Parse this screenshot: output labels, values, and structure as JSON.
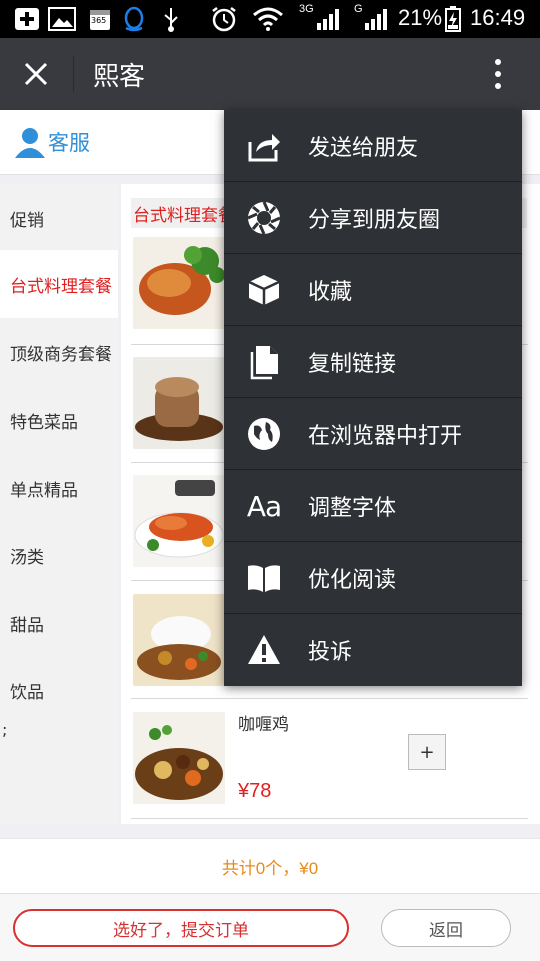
{
  "status_bar": {
    "battery": "21%",
    "time": "16:49",
    "network_a": "3G",
    "network_b": "G",
    "calendar_icon_text": "365",
    "icons": [
      "add-icon",
      "image-icon",
      "calendar-icon",
      "qq-icon",
      "usb-icon",
      "alarm-icon",
      "wifi-icon",
      "signal-icon",
      "signal-icon",
      "battery-charging-icon"
    ]
  },
  "titlebar": {
    "title": "熙客"
  },
  "service": {
    "label": "客服"
  },
  "sidebar": {
    "items": [
      {
        "label": "促销",
        "active": false
      },
      {
        "label": "台式料理套餐",
        "active": true
      },
      {
        "label": "顶级商务套餐",
        "active": false
      },
      {
        "label": "特色菜品",
        "active": false
      },
      {
        "label": "单点精品",
        "active": false
      },
      {
        "label": "汤类",
        "active": false
      },
      {
        "label": "甜品",
        "active": false
      },
      {
        "label": "饮品",
        "active": false
      }
    ],
    "stray": ";"
  },
  "product_list": {
    "category_header": "台式料理套餐",
    "visible_item": {
      "name": "咖喱鸡",
      "price": "¥78",
      "add_label": "+"
    }
  },
  "total": {
    "text": "共计0个，¥0"
  },
  "bottom": {
    "submit_label": "选好了，提交订单",
    "back_label": "返回"
  },
  "menu": {
    "items": [
      {
        "label": "发送给朋友",
        "icon": "share-icon"
      },
      {
        "label": "分享到朋友圈",
        "icon": "moments-icon"
      },
      {
        "label": "收藏",
        "icon": "favorite-box-icon"
      },
      {
        "label": "复制链接",
        "icon": "copy-link-icon"
      },
      {
        "label": "在浏览器中打开",
        "icon": "browser-globe-icon"
      },
      {
        "label": "调整字体",
        "icon": "font-size-icon"
      },
      {
        "label": "优化阅读",
        "icon": "reading-book-icon"
      },
      {
        "label": "投诉",
        "icon": "warning-icon"
      }
    ]
  },
  "colors": {
    "accent_red": "#e02020",
    "total_orange": "#e88a1a",
    "titlebar_bg": "#393a3f",
    "menu_bg": "#2e3135",
    "service_blue": "#2f8fd8"
  }
}
